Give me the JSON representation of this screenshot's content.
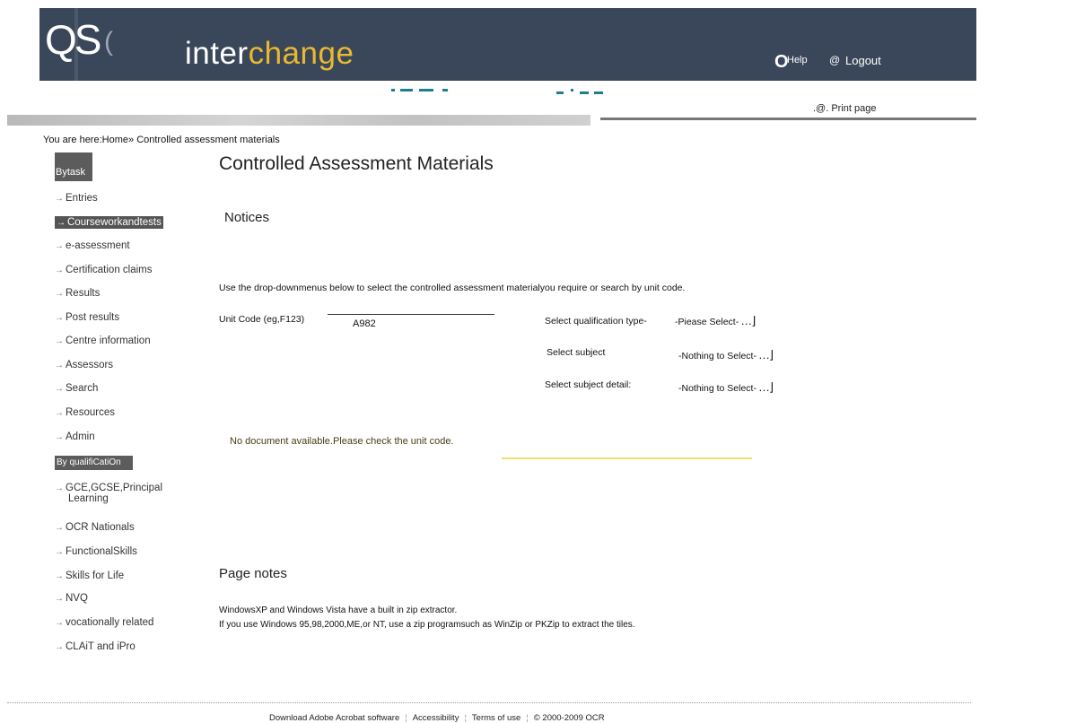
{
  "header": {
    "logo_text": "QS",
    "logo_mark": "(",
    "brand_prefix": "inter",
    "brand_accent": "change",
    "help_icon": "O",
    "help_label": "Help",
    "logout_icon": "@",
    "logout_label": "Logout"
  },
  "toolbar": {
    "print_icon": ".@.",
    "print_label": "Print page"
  },
  "breadcrumb": {
    "prefix": "You are here:",
    "home": "Home",
    "separator": "»",
    "current": "Controlled assessment materials"
  },
  "sidebar": {
    "by_task_heading": "Bytask",
    "by_task_items": [
      {
        "label": "Entries",
        "active": false
      },
      {
        "label": "Courseworkandtests",
        "active": true
      },
      {
        "label": "e-assessment",
        "active": false
      },
      {
        "label": "Certification claims",
        "active": false
      },
      {
        "label": "Results",
        "active": false
      },
      {
        "label": "Post results",
        "active": false
      },
      {
        "label": "Centre information",
        "active": false
      },
      {
        "label": "Assessors",
        "active": false
      },
      {
        "label": "Search",
        "active": false
      },
      {
        "label": "Resources",
        "active": false
      },
      {
        "label": "Admin",
        "active": false
      }
    ],
    "by_qual_heading": "By qualifiCatiOn",
    "by_qual_items": [
      {
        "label": "GCE,GCSE,Principal",
        "label2": "Learning"
      },
      {
        "label": "OCR Nationals"
      },
      {
        "label": "FunctionalSkills"
      },
      {
        "label": "Skills for Life"
      },
      {
        "label": "NVQ"
      },
      {
        "label": "vocationally related"
      },
      {
        "label": "CLAiT and iPro"
      }
    ]
  },
  "main": {
    "page_title": "Controlled Assessment Materials",
    "notices_title": "Notices",
    "instructions": "Use the drop-downmenus below to select the controlled assessment materialyou require or search by unit code.",
    "unit_code_label": "Unit Code (eg,F123)",
    "unit_code_value": "A982",
    "qualification_type_label": "Select qualification type-",
    "qualification_type_value": "-Piease Select-",
    "subject_label": "Select subject",
    "subject_value": "-Nothing to Select-",
    "subject_detail_label": "Select subject detail:",
    "subject_detail_value": "-Nothing to Select-",
    "no_document_message": "No document available.Please check the unit code.",
    "page_notes_title": "Page notes",
    "note_1": "WindowsXP and Windows Vista have a built in zip extractor.",
    "note_2": "If you use Windows 95,98,2000,ME,or NT, use a zip programsuch as WinZip or PKZip to extract the tiles."
  },
  "footer": {
    "acrobat": "Download Adobe Acrobat software",
    "accessibility": "Accessibility",
    "terms": "Terms of use",
    "copyright": "© 2000-2009 OCR"
  },
  "colors": {
    "header_bg": "#3a4659",
    "brand_accent": "#e8b931",
    "sidebar_active": "#555555",
    "decor_dash": "#1d7f8c"
  }
}
